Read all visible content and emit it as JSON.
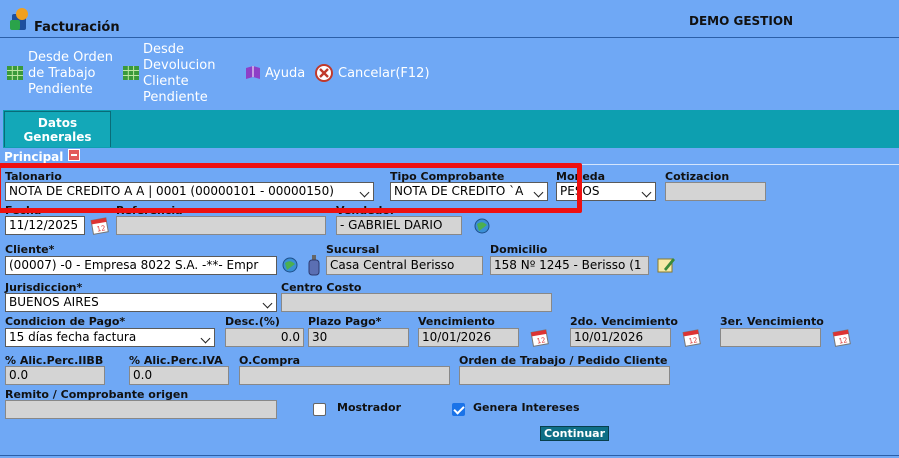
{
  "header": {
    "title": "Facturación",
    "company": "DEMO GESTION"
  },
  "toolbar": {
    "desde_orden": [
      "Desde Orden",
      "de Trabajo",
      "Pendiente"
    ],
    "desde_devolucion": [
      "Desde",
      "Devolucion",
      "Cliente",
      "Pendiente"
    ],
    "ayuda": "Ayuda",
    "cancelar": "Cancelar(F12)"
  },
  "tabs": {
    "datos_generales": [
      "Datos",
      "Generales"
    ]
  },
  "section": {
    "principal": "Principal"
  },
  "form": {
    "talonario": {
      "label": "Talonario",
      "value": "NOTA DE CREDITO A A | 0001 (00000101 - 00000150)"
    },
    "tipo_comprobante": {
      "label": "Tipo Comprobante",
      "value": "NOTA DE CREDITO `A"
    },
    "moneda": {
      "label": "Moneda",
      "value": "PESOS"
    },
    "cotizacion": {
      "label": "Cotizacion",
      "value": ""
    },
    "fecha": {
      "label": "Fecha",
      "value": "11/12/2025"
    },
    "referencia": {
      "label": "Referencia",
      "value": ""
    },
    "vendedor": {
      "label": "Vendedor",
      "value": "- GABRIEL DARIO"
    },
    "cliente": {
      "label": "Cliente*",
      "value": "(00007) -0 - Empresa 8022 S.A. -**- Empr"
    },
    "sucursal": {
      "label": "Sucursal",
      "value": "Casa Central Berisso"
    },
    "domicilio": {
      "label": "Domicilio",
      "value": "158 Nº 1245 - Berisso (1"
    },
    "jurisdiccion": {
      "label": "Jurisdiccion*",
      "value": "BUENOS AIRES"
    },
    "centro_costo": {
      "label": "Centro Costo",
      "value": ""
    },
    "condicion_pago": {
      "label": "Condicion de Pago*",
      "value": "15 días fecha factura"
    },
    "descuento": {
      "label": "Desc.(%)",
      "value": "0.0"
    },
    "plazo_pago": {
      "label": "Plazo Pago*",
      "value": "30"
    },
    "vencimiento": {
      "label": "Vencimiento",
      "value": "10/01/2026"
    },
    "vencimiento2": {
      "label": "2do. Vencimiento",
      "value": "10/01/2026"
    },
    "vencimiento3": {
      "label": "3er. Vencimiento",
      "value": ""
    },
    "alic_iibb": {
      "label": "% Alic.Perc.IIBB",
      "value": "0.0"
    },
    "alic_iva": {
      "label": "% Alic.Perc.IVA",
      "value": "0.0"
    },
    "ocompra": {
      "label": "O.Compra",
      "value": ""
    },
    "orden_trabajo": {
      "label": "Orden de Trabajo / Pedido Cliente",
      "value": ""
    },
    "remito": {
      "label": "Remito / Comprobante origen",
      "value": ""
    },
    "mostrador": {
      "label": "Mostrador",
      "checked": false
    },
    "genera_intereses": {
      "label": "Genera Intereses",
      "checked": true
    },
    "continuar": "Continuar"
  },
  "colors": {
    "background": "#6fa8f5",
    "tab": "#13a8b8",
    "highlight": "#ee1010",
    "button": "#0e6f86"
  },
  "icons": [
    "app-facturacion-icon",
    "grid-icon",
    "book-icon",
    "cancel-icon",
    "calendar-icon",
    "globe-icon",
    "bottle-icon",
    "edit-icon"
  ]
}
